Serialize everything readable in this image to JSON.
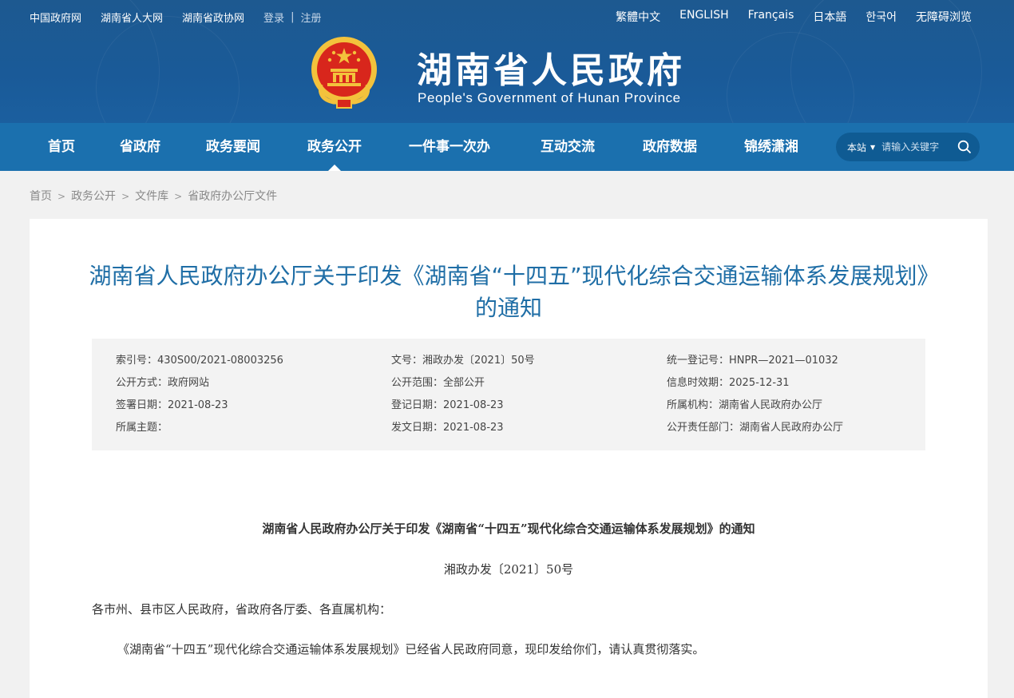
{
  "top_links": [
    "中国政府网",
    "湖南省人大网",
    "湖南省政协网"
  ],
  "account": {
    "login": "登录",
    "separator": "|",
    "register": "注册"
  },
  "languages": [
    "繁體中文",
    "ENGLISH",
    "Français",
    "日本語",
    "한국어",
    "无障碍浏览"
  ],
  "site": {
    "title": "湖南省人民政府",
    "subtitle": "People's Government of Hunan Province"
  },
  "nav": {
    "items": [
      "首页",
      "省政府",
      "政务要闻",
      "政务公开",
      "一件事一次办",
      "互动交流",
      "政府数据",
      "锦绣潇湘"
    ],
    "active": "政务公开"
  },
  "search": {
    "scope": "本站",
    "placeholder": "请输入关键字"
  },
  "breadcrumb": [
    "首页",
    "政务公开",
    "文件库",
    "省政府办公厅文件"
  ],
  "document": {
    "title": "湖南省人民政府办公厅关于印发《湖南省“十四五”现代化综合交通运输体系发展规划》的通知",
    "meta": [
      [
        "索引号：430S00/2021-08003256",
        "文号：湘政办发〔2021〕50号",
        "统一登记号：HNPR—2021—01032"
      ],
      [
        "公开方式：政府网站",
        "公开范围：全部公开",
        "信息时效期：2025-12-31"
      ],
      [
        "签署日期：2021-08-23",
        "登记日期：2021-08-23",
        "所属机构：湖南省人民政府办公厅"
      ],
      [
        "所属主题：",
        "发文日期：2021-08-23",
        "公开责任部门：湖南省人民政府办公厅"
      ]
    ],
    "body_title": "湖南省人民政府办公厅关于印发《湖南省“十四五”现代化综合交通运输体系发展规划》的通知",
    "doc_number": "湘政办发〔2021〕50号",
    "addressee": "各市州、县市区人民政府，省政府各厅委、各直属机构：",
    "paragraph1": "《湖南省“十四五”现代化综合交通运输体系发展规划》已经省人民政府同意，现印发给你们，请认真贯彻落实。"
  },
  "colors": {
    "header_bg": "#1d5990",
    "nav_bg": "#1b70ae",
    "title_blue": "#1f6ea6",
    "emblem_red": "#d8261c",
    "emblem_gold": "#f3c23c"
  }
}
